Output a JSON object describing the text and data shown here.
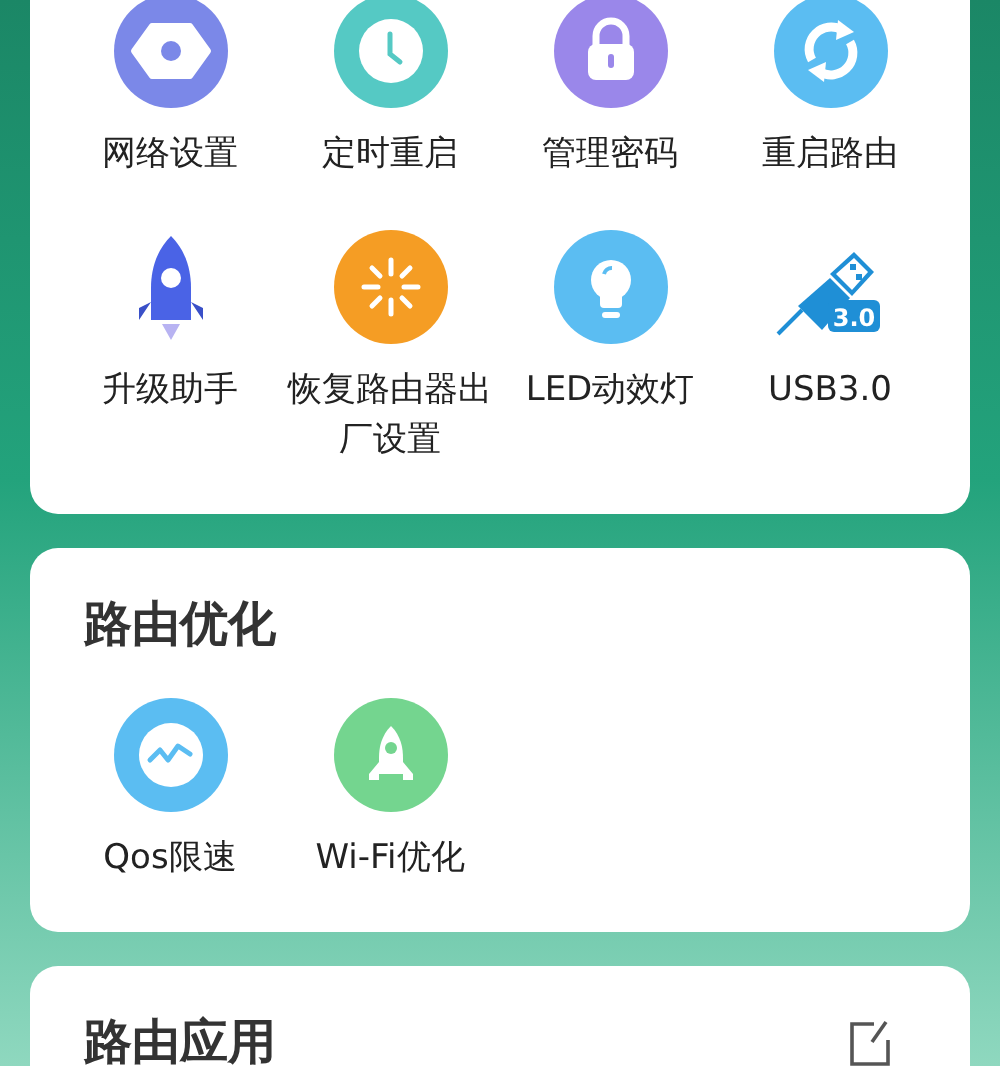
{
  "sections": [
    {
      "items": [
        {
          "kind": "nut",
          "label": "网络设置"
        },
        {
          "kind": "clock",
          "label": "定时重启"
        },
        {
          "kind": "lock",
          "label": "管理密码"
        },
        {
          "kind": "refresh",
          "label": "重启路由"
        },
        {
          "kind": "rocket",
          "label": "升级助手"
        },
        {
          "kind": "loader",
          "label": "恢复路由器出厂设置"
        },
        {
          "kind": "bulb",
          "label": "LED动效灯"
        },
        {
          "kind": "usb",
          "label": "USB3.0",
          "badge": "3.0"
        }
      ]
    },
    {
      "title": "路由优化",
      "items": [
        {
          "kind": "wave",
          "label": "Qos限速"
        },
        {
          "kind": "launch",
          "label": "Wi-Fi优化"
        }
      ]
    },
    {
      "title": "路由应用",
      "edit": true
    }
  ]
}
